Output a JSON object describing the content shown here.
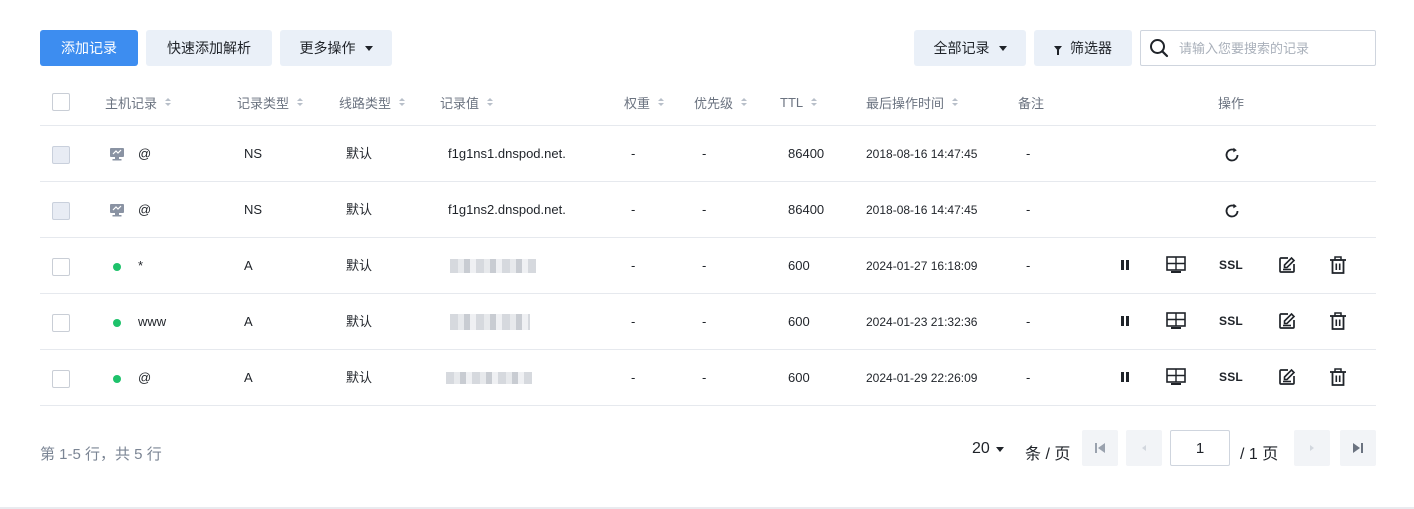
{
  "toolbar": {
    "add_record": "添加记录",
    "quick_add": "快速添加解析",
    "more_actions": "更多操作",
    "all_records": "全部记录",
    "filter": "筛选器",
    "search_placeholder": "请输入您要搜索的记录"
  },
  "table": {
    "headers": {
      "host": "主机记录",
      "type": "记录类型",
      "line": "线路类型",
      "value": "记录值",
      "weight": "权重",
      "priority": "优先级",
      "ttl": "TTL",
      "updated": "最后操作时间",
      "remark": "备注",
      "actions": "操作"
    },
    "rows": [
      {
        "host": "@",
        "type": "NS",
        "line": "默认",
        "value": "f1g1ns1.dnspod.net.",
        "weight": "-",
        "priority": "-",
        "ttl": "86400",
        "updated": "2018-08-16 14:47:45",
        "remark": "-",
        "system": true
      },
      {
        "host": "@",
        "type": "NS",
        "line": "默认",
        "value": "f1g1ns2.dnspod.net.",
        "weight": "-",
        "priority": "-",
        "ttl": "86400",
        "updated": "2018-08-16 14:47:45",
        "remark": "-",
        "system": true
      },
      {
        "host": "*",
        "type": "A",
        "line": "默认",
        "value": "",
        "weight": "-",
        "priority": "-",
        "ttl": "600",
        "updated": "2024-01-27 16:18:09",
        "remark": "-",
        "system": false
      },
      {
        "host": "www",
        "type": "A",
        "line": "默认",
        "value": "",
        "weight": "-",
        "priority": "-",
        "ttl": "600",
        "updated": "2024-01-23 21:32:36",
        "remark": "-",
        "system": false
      },
      {
        "host": "@",
        "type": "A",
        "line": "默认",
        "value": "",
        "weight": "-",
        "priority": "-",
        "ttl": "600",
        "updated": "2024-01-29 22:26:09",
        "remark": "-",
        "system": false
      }
    ],
    "ssl_label": "SSL"
  },
  "pager": {
    "summary": "第 1-5 行，共 5 行",
    "page_size": "20",
    "per_page_unit": "条 / 页",
    "current_page": "1",
    "total_pages": "/ 1 页"
  },
  "colors": {
    "primary": "#3d8df0",
    "status_enabled": "#1ec26b"
  }
}
